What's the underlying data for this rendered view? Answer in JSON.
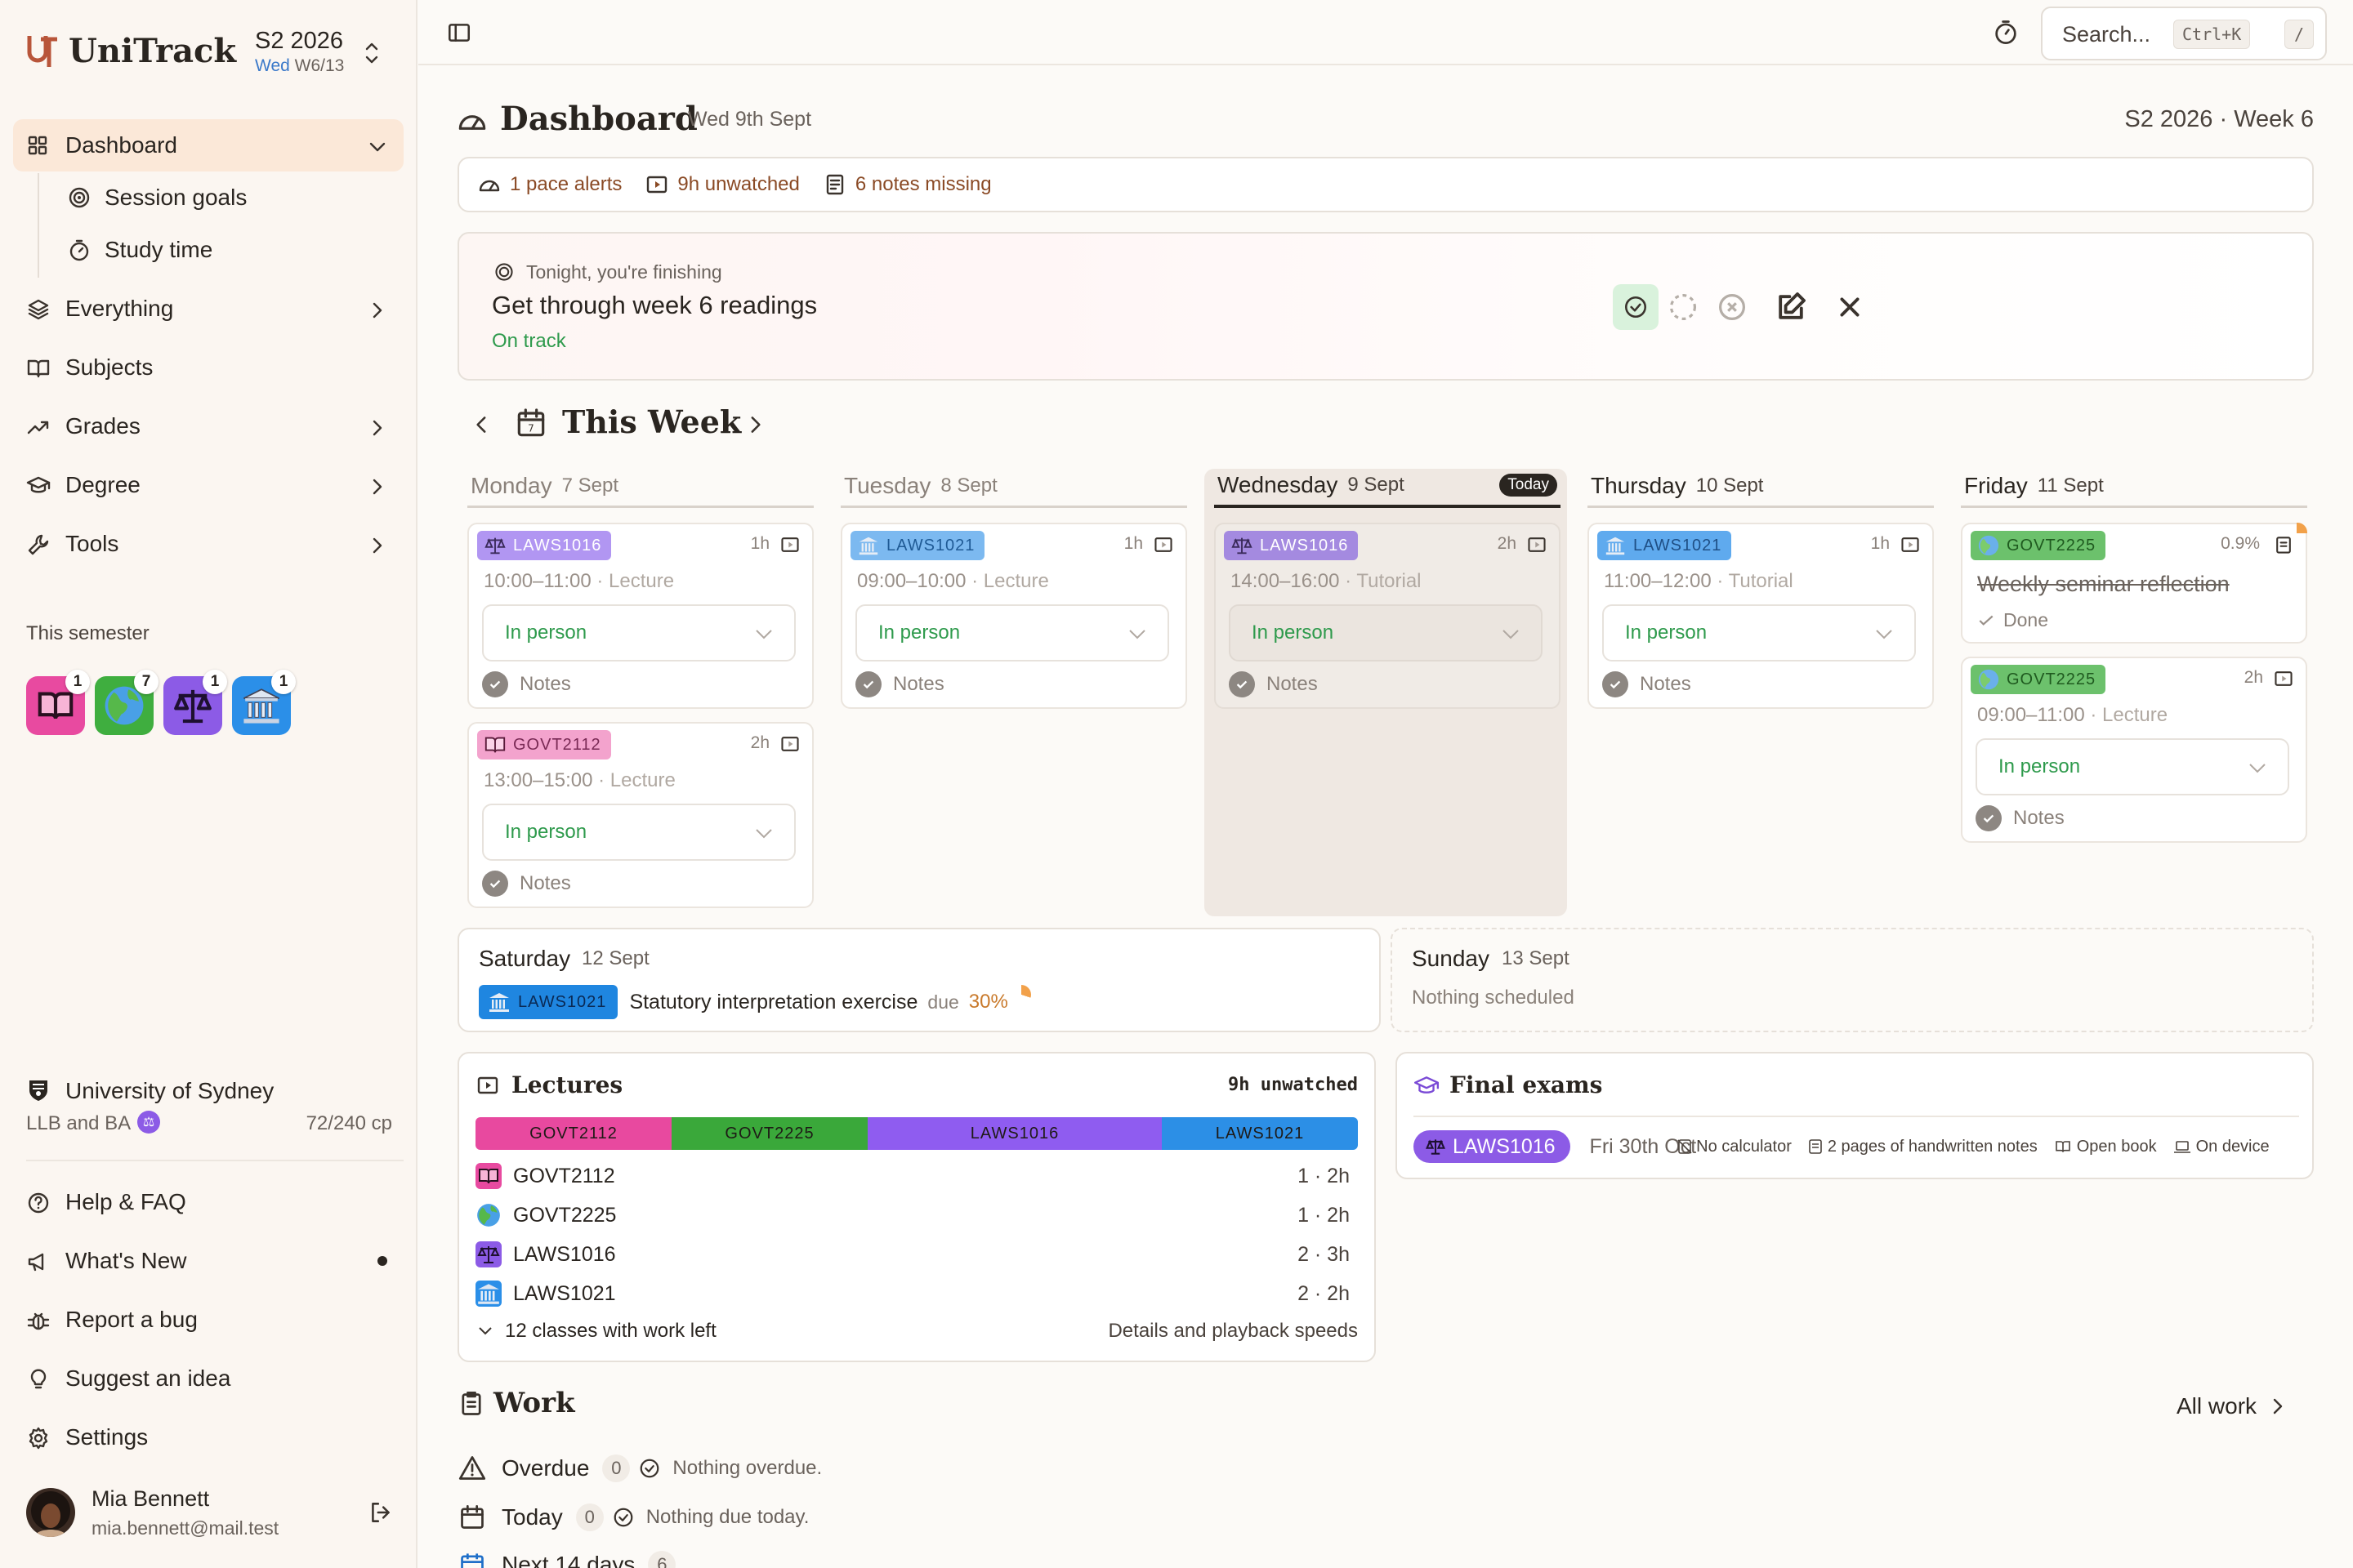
{
  "app": {
    "name": "UniTrack",
    "session": "S2 2026",
    "week_day": "Wed",
    "week_short": "W6/13"
  },
  "nav": {
    "dashboard": "Dashboard",
    "session_goals": "Session goals",
    "study_time": "Study time",
    "everything": "Everything",
    "subjects": "Subjects",
    "grades": "Grades",
    "degree": "Degree",
    "tools": "Tools"
  },
  "semester": {
    "label": "This semester",
    "subjects": [
      {
        "icon": "book-icon",
        "count": "1",
        "color": "#e84aa0"
      },
      {
        "icon": "globe-icon",
        "count": "7",
        "color": "#3fae3f"
      },
      {
        "icon": "scales-icon",
        "count": "1",
        "color": "#8c5be6"
      },
      {
        "icon": "bank-icon",
        "count": "1",
        "color": "#2b8fe8"
      }
    ]
  },
  "university": {
    "name": "University of Sydney",
    "degree": "LLB and BA",
    "credits": "72/240 cp"
  },
  "footer_nav": {
    "help": "Help & FAQ",
    "whats_new": "What's New",
    "report_bug": "Report a bug",
    "suggest": "Suggest an idea",
    "settings": "Settings"
  },
  "user": {
    "name": "Mia Bennett",
    "email": "mia.bennett@mail.test"
  },
  "topbar": {
    "search_placeholder": "Search...",
    "shortcut": "Ctrl+K",
    "slash": "/"
  },
  "header": {
    "title": "Dashboard",
    "date": "Wed 9th Sept",
    "week": "S2 2026 · Week 6"
  },
  "alerts": {
    "pace": "1 pace alerts",
    "unwatched": "9h unwatched",
    "notes": "6 notes missing"
  },
  "goal": {
    "kicker": "Tonight, you're finishing",
    "title": "Get through week 6 readings",
    "status": "On track"
  },
  "week": {
    "title": "This Week",
    "days": [
      {
        "name": "Monday",
        "date": "7 Sept"
      },
      {
        "name": "Tuesday",
        "date": "8 Sept"
      },
      {
        "name": "Wednesday",
        "date": "9 Sept",
        "today": "Today"
      },
      {
        "name": "Thursday",
        "date": "10 Sept"
      },
      {
        "name": "Friday",
        "date": "11 Sept"
      }
    ],
    "events": {
      "mon1": {
        "code": "LAWS1016",
        "dur": "1h",
        "time": "10:00–11:00",
        "type": "Lecture",
        "mode": "In person",
        "notes": "Notes"
      },
      "mon2": {
        "code": "GOVT2112",
        "dur": "2h",
        "time": "13:00–15:00",
        "type": "Lecture",
        "mode": "In person",
        "notes": "Notes"
      },
      "tue1": {
        "code": "LAWS1021",
        "dur": "1h",
        "time": "09:00–10:00",
        "type": "Lecture",
        "mode": "In person",
        "notes": "Notes"
      },
      "wed1": {
        "code": "LAWS1016",
        "dur": "2h",
        "time": "14:00–16:00",
        "type": "Tutorial",
        "mode": "In person",
        "notes": "Notes"
      },
      "thu1": {
        "code": "LAWS1021",
        "dur": "1h",
        "time": "11:00–12:00",
        "type": "Tutorial",
        "mode": "In person",
        "notes": "Notes"
      },
      "fri1": {
        "code": "GOVT2225",
        "pct": "0.9%",
        "title": "Weekly seminar reflection",
        "status": "Done"
      },
      "fri2": {
        "code": "GOVT2225",
        "dur": "2h",
        "time": "09:00–11:00",
        "type": "Lecture",
        "mode": "In person",
        "notes": "Notes"
      }
    },
    "saturday": {
      "name": "Saturday",
      "date": "12 Sept",
      "code": "LAWS1021",
      "task": "Statutory interpretation exercise",
      "due": "due",
      "pct": "30%"
    },
    "sunday": {
      "name": "Sunday",
      "date": "13 Sept",
      "empty": "Nothing scheduled"
    }
  },
  "lectures": {
    "title": "Lectures",
    "unwatched": "9h unwatched",
    "bar": [
      {
        "code": "GOVT2112",
        "hours": 2,
        "color": "#e8499f"
      },
      {
        "code": "GOVT2225",
        "hours": 2,
        "color": "#3aa83a"
      },
      {
        "code": "LAWS1016",
        "hours": 3,
        "color": "#8f5cf0"
      },
      {
        "code": "LAWS1021",
        "hours": 2,
        "color": "#2c8fe6"
      }
    ],
    "rows": [
      {
        "code": "GOVT2112",
        "value": "1 · 2h"
      },
      {
        "code": "GOVT2225",
        "value": "1 · 2h"
      },
      {
        "code": "LAWS1016",
        "value": "2 · 3h"
      },
      {
        "code": "LAWS1021",
        "value": "2 · 2h"
      }
    ],
    "footer_left": "12 classes with work left",
    "footer_right": "Details and playback speeds"
  },
  "exams": {
    "title": "Final exams",
    "code": "LAWS1016",
    "date": "Fri 30th Oct",
    "no_calc": "No calculator",
    "notes": "2 pages of handwritten notes",
    "open_book": "Open book",
    "device": "On device"
  },
  "work": {
    "title": "Work",
    "all": "All work",
    "overdue": {
      "label": "Overdue",
      "count": "0",
      "msg": "Nothing overdue."
    },
    "today": {
      "label": "Today",
      "count": "0",
      "msg": "Nothing due today."
    },
    "next": {
      "label": "Next 14 days",
      "count": "6"
    }
  },
  "colors": {
    "accent": "#b8553a",
    "green": "#2e9a4c",
    "laws1016": "#a98af0",
    "laws1021": "#5ba9ee",
    "govt2112": "#f08ec3",
    "govt2225": "#5bbb5b"
  }
}
